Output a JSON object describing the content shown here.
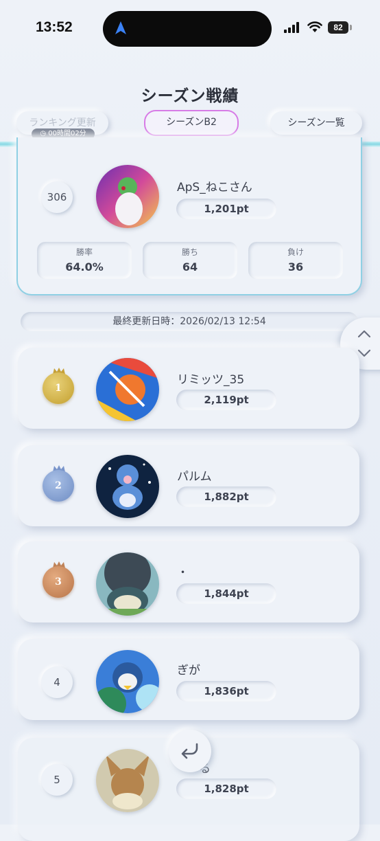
{
  "status": {
    "time": "13:52",
    "battery": "82"
  },
  "page_title": "シーズン戦績",
  "tabs": {
    "ranking_update": "ランキング更新",
    "refresh_timer": "00時間02分",
    "season": "シーズンB2",
    "season_list": "シーズン一覧"
  },
  "my_card": {
    "rank": "306",
    "name": "ApS_ねこさん",
    "points": "1,201pt",
    "stats": [
      {
        "label": "勝率",
        "value": "64.0%"
      },
      {
        "label": "勝ち",
        "value": "64"
      },
      {
        "label": "負け",
        "value": "36"
      }
    ]
  },
  "last_updated": "最終更新日時：2026/02/13 12:54",
  "ranking": [
    {
      "rank": "1",
      "name": "リミッツ_35",
      "points": "2,119pt",
      "medal": "gold",
      "avatar_colors": [
        "#e94b3c",
        "#2a6fd6",
        "#f5c431"
      ]
    },
    {
      "rank": "2",
      "name": "パルム",
      "points": "1,882pt",
      "medal": "silver",
      "avatar_colors": [
        "#0f2340",
        "#5a8fd8",
        "#e8eefb"
      ]
    },
    {
      "rank": "3",
      "name": "・",
      "points": "1,844pt",
      "medal": "bronze",
      "avatar_colors": [
        "#3d4a55",
        "#89b8c0",
        "#e9e6d0"
      ]
    },
    {
      "rank": "4",
      "name": "ぎが",
      "points": "1,836pt",
      "medal": "",
      "avatar_colors": [
        "#2e8a5a",
        "#3a7ed8",
        "#aee3f5"
      ]
    },
    {
      "rank": "5",
      "name": "る",
      "points": "1,828pt",
      "medal": "",
      "avatar_colors": [
        "#cfc6a8",
        "#b07a3c",
        "#f0e6c8"
      ]
    }
  ],
  "colors": {
    "background": "#eef2f8",
    "season_border": "#d77be6",
    "accent_cyan": "#87d8e4",
    "gold": "#c39f2e",
    "silver": "#6f8dc4",
    "bronze": "#b87448"
  }
}
